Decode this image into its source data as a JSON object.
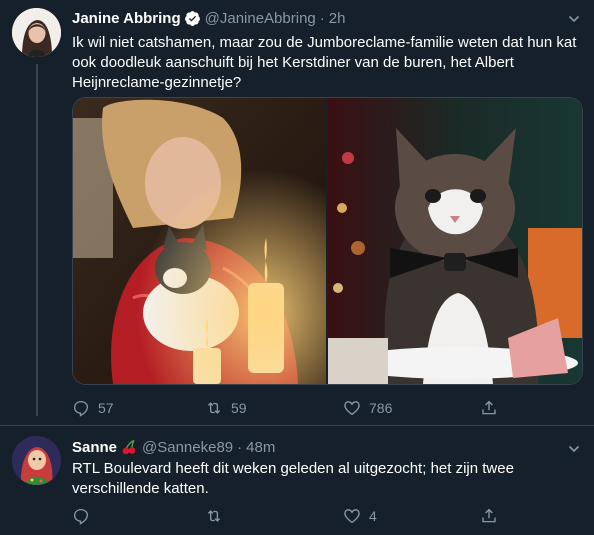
{
  "tweet1": {
    "name": "Janine Abbring",
    "handle": "@JanineAbbring",
    "sep": "·",
    "time": "2h",
    "text_line1": "Ik wil niet catshamen, maar zou de Jumboreclame-familie weten dat hun kat",
    "text_line2": "ook doodleuk aanschuift bij het Kerstdiner van de buren, het Albert",
    "text_line3": "Heijnreclame-gezinnetje?",
    "reply_count": "57",
    "retweet_count": "59",
    "like_count": "786"
  },
  "tweet2": {
    "name": "Sanne",
    "handle": "@Sanneke89",
    "sep": "·",
    "time": "48m",
    "text_line1": "RTL Boulevard heeft dit weken geleden al uitgezocht; het zijn twee",
    "text_line2": "verschillende katten.",
    "reply_count": "",
    "retweet_count": "",
    "like_count": "4"
  },
  "icons": {
    "verified": "verified-badge-icon",
    "cherry": "cherry-emoji-icon",
    "caret": "chevron-down-icon",
    "reply": "reply-icon",
    "retweet": "retweet-icon",
    "like": "heart-icon",
    "share": "share-icon"
  },
  "colors": {
    "background": "#15202b",
    "text": "#ffffff",
    "muted": "#8899a6",
    "verified": "#ffffff",
    "border": "#38444d"
  }
}
